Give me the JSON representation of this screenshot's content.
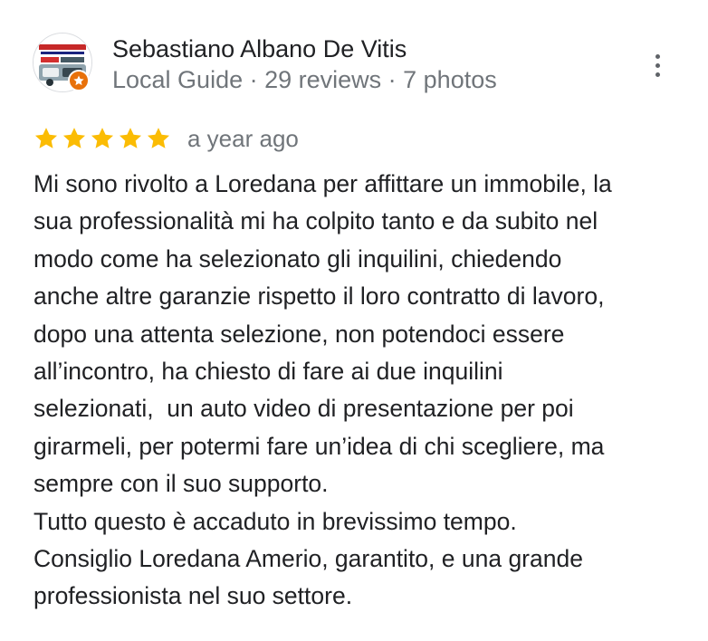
{
  "reviewer": {
    "name": "Sebastiano Albano De Vitis",
    "meta": "Local Guide · 29 reviews · 7 photos",
    "avatar_icon": "carrozzeria-logo-avatar",
    "badge_icon": "local-guide-star-icon"
  },
  "menu": {
    "icon": "more-vert-icon"
  },
  "rating": {
    "stars": 5,
    "max_stars": 5,
    "star_color": "#fbbc04",
    "date": "a year ago"
  },
  "review": {
    "lines": [
      "Mi sono rivolto a Loredana per affittare un immobile, la",
      "sua professionalità mi ha colpito tanto e da subito nel",
      "modo come ha selezionato gli inquilini, chiedendo",
      "anche altre garanzie rispetto il loro contratto di lavoro,",
      "dopo una attenta selezione, non potendoci essere",
      "all’incontro, ha chiesto di fare ai due inquilini",
      "selezionati,  un auto video di presentazione per poi",
      "girarmeli, per potermi fare un’idea di chi scegliere, ma",
      "sempre con il suo supporto.",
      "Tutto questo è accaduto in brevissimo tempo.",
      "Consiglio Loredana Amerio, garantito, e una grande",
      "professionista nel suo settore."
    ]
  },
  "colors": {
    "name": "#202124",
    "secondary": "#70757a",
    "badge": "#e8710a"
  }
}
